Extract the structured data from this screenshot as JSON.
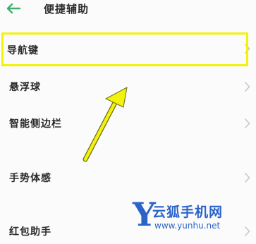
{
  "header": {
    "title": "便捷辅助",
    "back_icon": "back-arrow-icon",
    "back_icon_color": "#3fae6a"
  },
  "settings_list": [
    {
      "label": "导航键",
      "icon": "chevron-right-icon"
    },
    {
      "label": "悬浮球",
      "icon": "chevron-right-icon"
    },
    {
      "label": "智能侧边栏",
      "icon": "chevron-right-icon"
    },
    {
      "label": "手势体感",
      "icon": "chevron-right-icon"
    },
    {
      "label": "红包助手",
      "icon": "chevron-right-icon"
    }
  ],
  "annotation": {
    "highlight_color": "#f2f20a",
    "arrow_color": "#f2f20a"
  },
  "watermark": {
    "logo_letter": "Y",
    "site_name": "云狐手机网",
    "url": "www.yunhu.net",
    "color": "#2b64c8"
  }
}
